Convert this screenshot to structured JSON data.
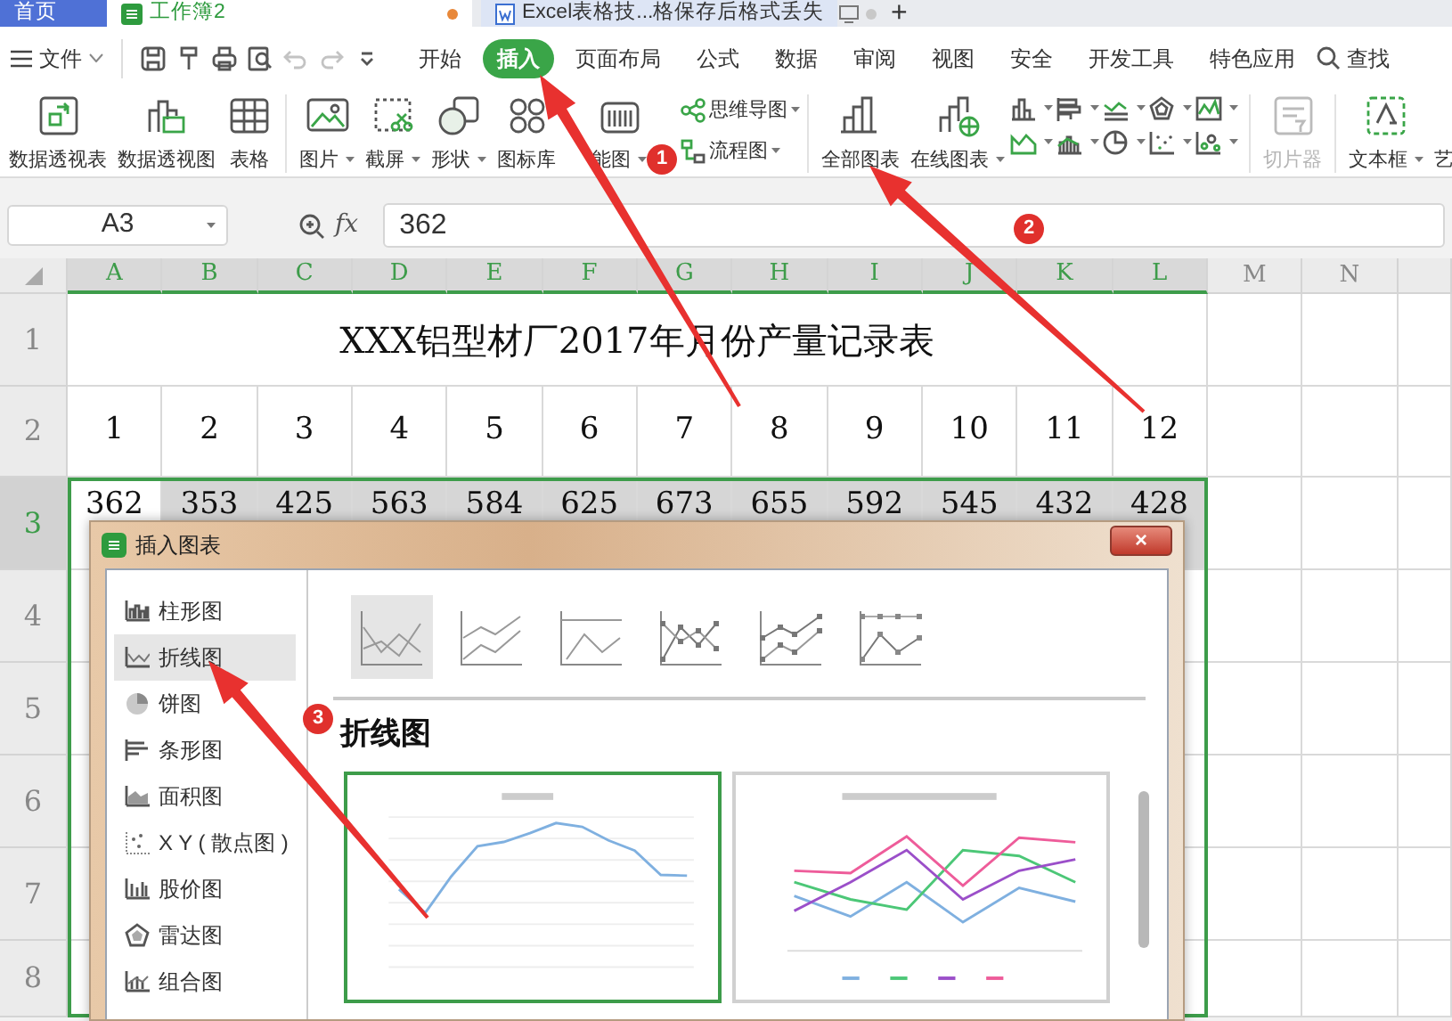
{
  "tabs": [
    {
      "label": "首页",
      "kind": "home",
      "selected": false
    },
    {
      "label": "工作簿2",
      "kind": "sheet",
      "selected": true,
      "color": "#e8883a"
    },
    {
      "label": "Excel表格技...格保存后格式丢失",
      "kind": "doc",
      "selected": false,
      "color": "#c8c8c8"
    }
  ],
  "new_tab": "+",
  "menu": {
    "file": "文件",
    "quick_tools": [
      {
        "kind": "save",
        "disabled": false
      },
      {
        "kind": "painter",
        "disabled": false
      },
      {
        "kind": "print",
        "disabled": false
      },
      {
        "kind": "preview",
        "disabled": false
      },
      {
        "kind": "undo",
        "disabled": true
      },
      {
        "kind": "redo",
        "disabled": true
      },
      {
        "kind": "more",
        "disabled": false
      }
    ],
    "tabs": [
      {
        "label": "开始",
        "selected": false
      },
      {
        "label": "插入",
        "selected": true
      },
      {
        "label": "页面布局",
        "selected": false
      },
      {
        "label": "公式",
        "selected": false
      },
      {
        "label": "数据",
        "selected": false
      },
      {
        "label": "审阅",
        "selected": false
      },
      {
        "label": "视图",
        "selected": false
      },
      {
        "label": "安全",
        "selected": false
      },
      {
        "label": "开发工具",
        "selected": false
      },
      {
        "label": "特色应用",
        "selected": false
      }
    ],
    "search": "查找"
  },
  "ribbon": [
    {
      "kind": "large",
      "label": "数据透视表",
      "dropdown": false,
      "disabled": false
    },
    {
      "kind": "large",
      "label": "数据透视图",
      "dropdown": false,
      "disabled": false
    },
    {
      "kind": "large",
      "label": "表格",
      "dropdown": false,
      "disabled": false
    },
    {
      "kind": "separator"
    },
    {
      "kind": "large",
      "label": "图片",
      "dropdown": true,
      "disabled": false
    },
    {
      "kind": "large",
      "label": "截屏",
      "dropdown": true,
      "disabled": false
    },
    {
      "kind": "large",
      "label": "形状",
      "dropdown": true,
      "disabled": false
    },
    {
      "kind": "large",
      "label": "图标库",
      "dropdown": false,
      "disabled": false
    },
    {
      "kind": "large",
      "label": "能图",
      "dropdown": true,
      "disabled": false
    },
    {
      "kind": "stack",
      "items": [
        {
          "label": "思维导图",
          "dropdown": true
        },
        {
          "label": "流程图",
          "dropdown": true
        }
      ]
    },
    {
      "kind": "separator"
    },
    {
      "kind": "large",
      "label": "全部图表",
      "dropdown": false,
      "disabled": false
    },
    {
      "kind": "large",
      "label": "在线图表",
      "dropdown": true,
      "disabled": false
    },
    {
      "kind": "grid",
      "items": [
        {
          "dropdown": true
        },
        {
          "dropdown": true
        },
        {
          "dropdown": true
        },
        {
          "dropdown": true
        },
        {
          "dropdown": true
        },
        {
          "dropdown": true
        },
        {
          "dropdown": true
        },
        {
          "dropdown": true
        },
        {
          "dropdown": true
        },
        {
          "dropdown": true
        }
      ]
    },
    {
      "kind": "separator"
    },
    {
      "kind": "large",
      "label": "切片器",
      "dropdown": false,
      "disabled": true
    },
    {
      "kind": "separator"
    },
    {
      "kind": "large",
      "label": "文本框",
      "dropdown": true,
      "disabled": false
    },
    {
      "kind": "large",
      "label": "艺",
      "dropdown": false,
      "disabled": false
    }
  ],
  "formula_bar": {
    "cell": "A3",
    "fx": "fx",
    "value": "362"
  },
  "sheet": {
    "columns": [
      {
        "label": "A",
        "selected": true
      },
      {
        "label": "B",
        "selected": true
      },
      {
        "label": "C",
        "selected": true
      },
      {
        "label": "D",
        "selected": true
      },
      {
        "label": "E",
        "selected": true
      },
      {
        "label": "F",
        "selected": true
      },
      {
        "label": "G",
        "selected": true
      },
      {
        "label": "H",
        "selected": true
      },
      {
        "label": "I",
        "selected": true
      },
      {
        "label": "J",
        "selected": true
      },
      {
        "label": "K",
        "selected": true
      },
      {
        "label": "L",
        "selected": true
      },
      {
        "label": "M",
        "selected": false
      },
      {
        "label": "N",
        "selected": false
      }
    ],
    "rows": [
      {
        "header": "1",
        "selected": false,
        "kind": "title",
        "title": "XXX铝型材厂2017年月份产量记录表"
      },
      {
        "header": "2",
        "selected": false,
        "kind": "cells",
        "cells": [
          "1",
          "2",
          "3",
          "4",
          "5",
          "6",
          "7",
          "8",
          "9",
          "10",
          "11",
          "12"
        ]
      },
      {
        "header": "3",
        "selected": true,
        "kind": "cells",
        "cells": [
          "362",
          "353",
          "425",
          "563",
          "584",
          "625",
          "673",
          "655",
          "592",
          "545",
          "432",
          "428"
        ]
      },
      {
        "header": "4",
        "selected": false,
        "kind": "empty"
      },
      {
        "header": "5",
        "selected": false,
        "kind": "empty"
      },
      {
        "header": "6",
        "selected": false,
        "kind": "empty"
      },
      {
        "header": "7",
        "selected": false,
        "kind": "empty"
      },
      {
        "header": "8",
        "selected": false,
        "kind": "empty"
      }
    ]
  },
  "dialog": {
    "title": "插入图表",
    "close": "×",
    "categories": [
      {
        "label": "柱形图",
        "kind": "column",
        "selected": false
      },
      {
        "label": "折线图",
        "kind": "line",
        "selected": true
      },
      {
        "label": "饼图",
        "kind": "pie",
        "selected": false
      },
      {
        "label": "条形图",
        "kind": "bar",
        "selected": false
      },
      {
        "label": "面积图",
        "kind": "area",
        "selected": false
      },
      {
        "label": "X Y ( 散点图 )",
        "kind": "scatter",
        "selected": false
      },
      {
        "label": "股价图",
        "kind": "stock",
        "selected": false
      },
      {
        "label": "雷达图",
        "kind": "radar",
        "selected": false
      },
      {
        "label": "组合图",
        "kind": "combo",
        "selected": false
      }
    ],
    "subtypes": [
      {
        "kind": "line",
        "selected": true
      },
      {
        "kind": "stacked",
        "selected": false
      },
      {
        "kind": "percent",
        "selected": false
      },
      {
        "kind": "markers",
        "selected": false
      },
      {
        "kind": "stacked-markers",
        "selected": false
      },
      {
        "kind": "percent-markers",
        "selected": false
      }
    ],
    "heading": "折线图",
    "previews": [
      {
        "kind": "single",
        "selected": true
      },
      {
        "kind": "multi",
        "selected": false
      }
    ]
  },
  "annotations": [
    {
      "label": "1"
    },
    {
      "label": "2"
    },
    {
      "label": "3"
    }
  ]
}
